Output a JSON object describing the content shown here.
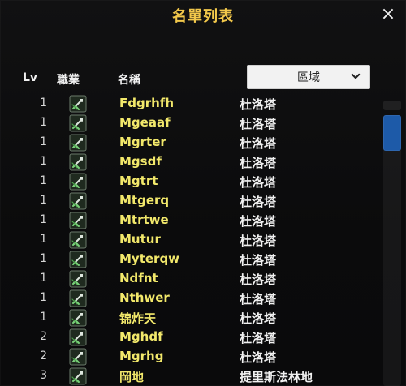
{
  "window": {
    "title": "名單列表",
    "close_icon": "×"
  },
  "columns": {
    "lv": "Lv",
    "job": "職業",
    "name": "名稱"
  },
  "filter": {
    "selected": "區域"
  },
  "rows": [
    {
      "lv": "1",
      "name": "Fdgrhfh",
      "area": "杜洛塔"
    },
    {
      "lv": "1",
      "name": "Mgeaaf",
      "area": "杜洛塔"
    },
    {
      "lv": "1",
      "name": "Mgrter",
      "area": "杜洛塔"
    },
    {
      "lv": "1",
      "name": "Mgsdf",
      "area": "杜洛塔"
    },
    {
      "lv": "1",
      "name": "Mgtrt",
      "area": "杜洛塔"
    },
    {
      "lv": "1",
      "name": "Mtgerq",
      "area": "杜洛塔"
    },
    {
      "lv": "1",
      "name": "Mtrtwe",
      "area": "杜洛塔"
    },
    {
      "lv": "1",
      "name": "Mutur",
      "area": "杜洛塔"
    },
    {
      "lv": "1",
      "name": "Myterqw",
      "area": "杜洛塔"
    },
    {
      "lv": "1",
      "name": "Ndfnt",
      "area": "杜洛塔"
    },
    {
      "lv": "1",
      "name": "Nthwer",
      "area": "杜洛塔"
    },
    {
      "lv": "1",
      "name": "锦炸天",
      "area": "杜洛塔"
    },
    {
      "lv": "2",
      "name": "Mghdf",
      "area": "杜洛塔"
    },
    {
      "lv": "2",
      "name": "Mgrhg",
      "area": "杜洛塔"
    },
    {
      "lv": "3",
      "name": "岡地",
      "area": "提里斯法林地"
    }
  ],
  "colors": {
    "title": "#f2c84b",
    "name": "#f2e86b",
    "scroll_thumb": "#1d5aa8"
  }
}
